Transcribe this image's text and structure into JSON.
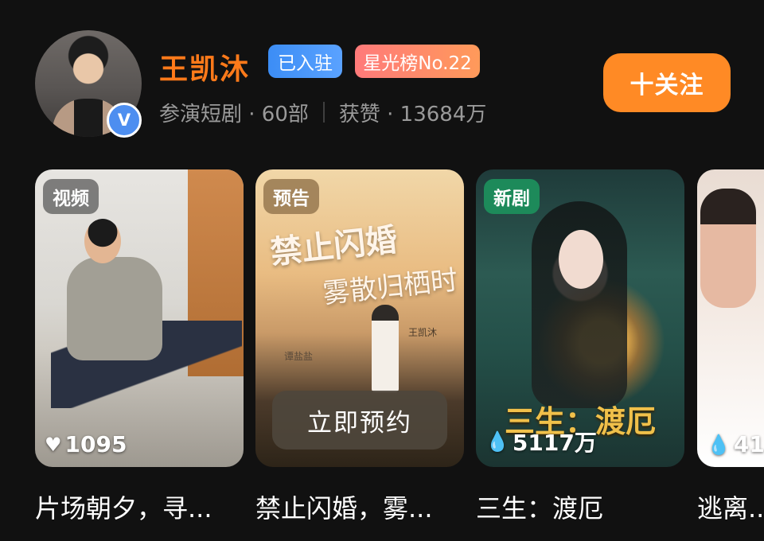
{
  "profile": {
    "name": "王凯沐",
    "verified_icon": "V",
    "badges": {
      "joined": "已入驻",
      "rank": "星光榜No.22"
    },
    "stats": {
      "dramas": "参演短剧 · 60部",
      "likes": "获赞 · 13684万"
    },
    "follow_label": "十关注"
  },
  "cards": [
    {
      "tag": "视频",
      "count_icon": "heart-icon",
      "count": "1095",
      "title": "片场朝夕，寻..."
    },
    {
      "tag": "预告",
      "poster_title": "禁止闪婚",
      "poster_sub": "雾散归栖时",
      "credit_left": "谭盐盐",
      "credit_right": "王凯沐",
      "button": "立即预约",
      "title": "禁止闪婚，雾..."
    },
    {
      "tag": "新剧",
      "count_icon": "flame-icon",
      "count": "5117万",
      "poster_title": "三生：渡厄",
      "title": "三生：渡厄"
    },
    {
      "count_icon": "flame-icon",
      "count": "41",
      "title": "逃离..."
    }
  ],
  "colors": {
    "accent": "#ff8a25",
    "name": "#ff7a1a",
    "background": "#111111"
  }
}
